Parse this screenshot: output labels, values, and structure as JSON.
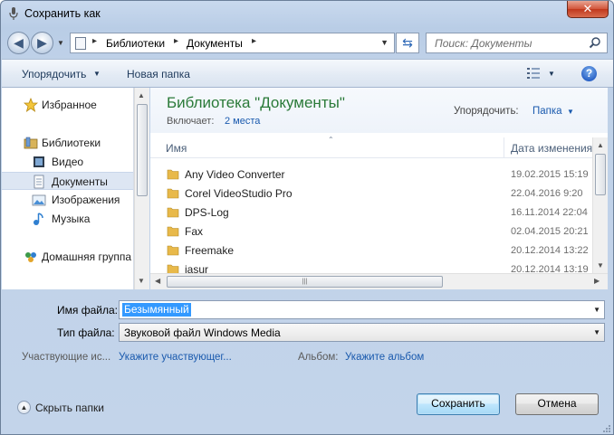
{
  "window": {
    "title": "Сохранить как",
    "close_label": "✕"
  },
  "address": {
    "breadcrumb": [
      "Библиотеки",
      "Документы"
    ],
    "separator": "▸"
  },
  "search": {
    "placeholder": "Поиск: Документы"
  },
  "toolbar": {
    "organize_label": "Упорядочить",
    "new_folder_label": "Новая папка",
    "help_label": "?"
  },
  "navigation": {
    "items": [
      {
        "label": "Избранное",
        "icon": "star-icon"
      },
      {
        "label": "Библиотеки",
        "icon": "libraries-icon"
      },
      {
        "label": "Видео",
        "icon": "video-icon"
      },
      {
        "label": "Документы",
        "icon": "documents-icon",
        "selected": true
      },
      {
        "label": "Изображения",
        "icon": "images-icon"
      },
      {
        "label": "Музыка",
        "icon": "music-icon"
      },
      {
        "label": "Домашняя группа",
        "icon": "homegroup-icon"
      }
    ]
  },
  "library": {
    "title": "Библиотека \"Документы\"",
    "includes_label": "Включает:",
    "includes_link": "2 места",
    "arrange_label": "Упорядочить:",
    "arrange_value": "Папка"
  },
  "columns": {
    "name": "Имя",
    "date": "Дата изменения"
  },
  "files": [
    {
      "name": "Any Video Converter",
      "date": "19.02.2015 15:19"
    },
    {
      "name": "Corel VideoStudio Pro",
      "date": "22.04.2016 9:20"
    },
    {
      "name": "DPS-Log",
      "date": "16.11.2014 22:04"
    },
    {
      "name": "Fax",
      "date": "02.04.2015 20:21"
    },
    {
      "name": "Freemake",
      "date": "20.12.2014 13:22"
    },
    {
      "name": "jasur",
      "date": "20.12.2014 13:19"
    }
  ],
  "form": {
    "filename_label": "Имя файла:",
    "filename_value": "Безымянный",
    "filetype_label": "Тип файла:",
    "filetype_value": "Звуковой файл Windows Media",
    "contributors_label": "Участвующие ис...",
    "contributors_link": "Укажите участвующег...",
    "album_label": "Альбом:",
    "album_link": "Укажите альбом",
    "hide_folders_label": "Скрыть папки",
    "save_label": "Сохранить",
    "cancel_label": "Отмена"
  },
  "colors": {
    "library_title": "#2a7a38",
    "link": "#1a5aae",
    "selection": "#3399ff",
    "folder": "#e8b94a"
  }
}
